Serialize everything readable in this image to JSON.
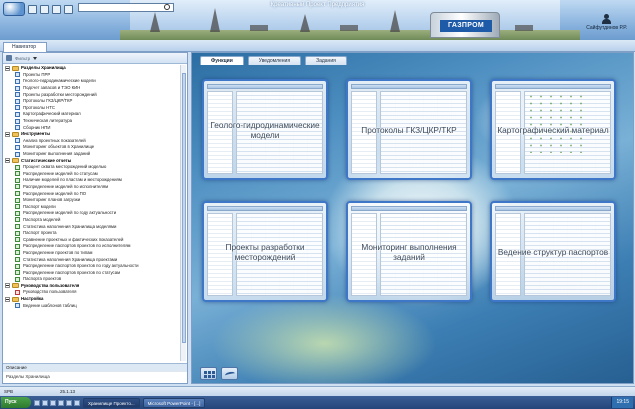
{
  "window": {
    "title": "Креативный Проект Предприятия"
  },
  "header": {
    "brand": "ГАЗПРОМ",
    "user_name": "Сайфутдинов Р.Р."
  },
  "tabs": {
    "navigator": "Навигатор"
  },
  "navigator": {
    "toolbar_label": "Фильтр",
    "tree": [
      {
        "type": "section",
        "label": "Разделы Хранилища"
      },
      {
        "type": "item",
        "label": "Проекты ПРР",
        "icon": "doc"
      },
      {
        "type": "item",
        "label": "Геолого-гидродинамические модели",
        "icon": "doc"
      },
      {
        "type": "item",
        "label": "Подсчет запасов и ТЭО КИН",
        "icon": "doc"
      },
      {
        "type": "item",
        "label": "Проекты разработки месторождений",
        "icon": "doc"
      },
      {
        "type": "item",
        "label": "Протоколы ГКЗ/ЦКР/ТКР",
        "icon": "doc"
      },
      {
        "type": "item",
        "label": "Протоколы НТС",
        "icon": "doc"
      },
      {
        "type": "item",
        "label": "Картографический материал",
        "icon": "doc"
      },
      {
        "type": "item",
        "label": "Техническая литература",
        "icon": "doc"
      },
      {
        "type": "item",
        "label": "Сборник НПИ",
        "icon": "doc"
      },
      {
        "type": "section",
        "label": "Инструменты"
      },
      {
        "type": "item",
        "label": "Анализ проектных показателей",
        "icon": "doc"
      },
      {
        "type": "item",
        "label": "Мониторинг объектов в Хранилище",
        "icon": "doc"
      },
      {
        "type": "item",
        "label": "Мониторинг выполнения заданий",
        "icon": "doc"
      },
      {
        "type": "section",
        "label": "Статистические отчеты"
      },
      {
        "type": "item",
        "label": "Процент охвата месторождений моделью",
        "icon": "green"
      },
      {
        "type": "item",
        "label": "Распределение моделей по статусам",
        "icon": "green"
      },
      {
        "type": "item",
        "label": "Наличие моделей по пластам и месторождениям",
        "icon": "green"
      },
      {
        "type": "item",
        "label": "Распределение моделей по исполнителям",
        "icon": "green"
      },
      {
        "type": "item",
        "label": "Распределение моделей по ПО",
        "icon": "green"
      },
      {
        "type": "item",
        "label": "Мониторинг планов загрузки",
        "icon": "green"
      },
      {
        "type": "item",
        "label": "Паспорт модели",
        "icon": "green"
      },
      {
        "type": "item",
        "label": "Распределение моделей по году актуальности",
        "icon": "green"
      },
      {
        "type": "item",
        "label": "Паспорта моделей",
        "icon": "green"
      },
      {
        "type": "item",
        "label": "Статистика наполнения Хранилища моделями",
        "icon": "green"
      },
      {
        "type": "item",
        "label": "Паспорт проекта",
        "icon": "green"
      },
      {
        "type": "item",
        "label": "Сравнение проектных и фактических показателей",
        "icon": "green"
      },
      {
        "type": "item",
        "label": "Распределение паспортов проектов по исполнителям",
        "icon": "green"
      },
      {
        "type": "item",
        "label": "Распределение проектов по типам",
        "icon": "green"
      },
      {
        "type": "item",
        "label": "Статистика наполнения Хранилища проектами",
        "icon": "green"
      },
      {
        "type": "item",
        "label": "Распределение паспортов проектов по году актуальности",
        "icon": "green"
      },
      {
        "type": "item",
        "label": "Распределение паспортов проектов по статусам",
        "icon": "green"
      },
      {
        "type": "item",
        "label": "Паспорта проектов",
        "icon": "green"
      },
      {
        "type": "section",
        "label": "Руководства пользователя"
      },
      {
        "type": "item",
        "label": "Руководство пользователя",
        "icon": "pdf"
      },
      {
        "type": "section",
        "label": "Настройка"
      },
      {
        "type": "item",
        "label": "Ведение шаблонов таблиц",
        "icon": "doc"
      }
    ],
    "description_label": "Описание",
    "description_text": "Разделы Хранилища"
  },
  "main": {
    "tabs": [
      "Функции",
      "Уведомления",
      "Задания"
    ],
    "active_tab": "Функции",
    "tiles": [
      "Геолого-гидродинамические модели",
      "Протоколы ГКЗ/ЦКР/ТКР",
      "Картографический материал",
      "Проекты разработки месторождений",
      "Мониторинг выполнения заданий",
      "Ведение структур паспортов"
    ]
  },
  "statusbar": {
    "left": "SPB",
    "right": "25.1.13"
  },
  "taskbar": {
    "start": "Пуск",
    "tasks": [
      "Хранилище Проекто...",
      "Microsoft PowerPoint - [...]"
    ],
    "clock": "19:15"
  },
  "colors": {
    "accent": "#3e76c8",
    "banner": "#8fb7e0",
    "tile_border": "#3e76c8"
  }
}
